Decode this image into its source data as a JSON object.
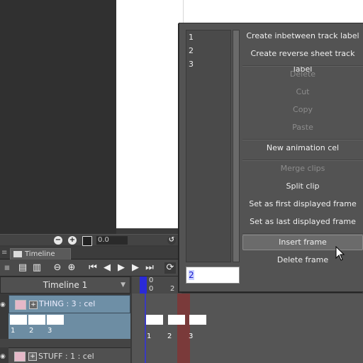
{
  "canvas": {
    "zoom_value": "0.0"
  },
  "panel": {
    "tab_label": "Timeline"
  },
  "timeline": {
    "name": "Timeline 1",
    "ruler_labels": [
      "0",
      "0",
      "2"
    ]
  },
  "layers": [
    {
      "label": "THING : 3 : cel",
      "cell_numbers": [
        "1",
        "2",
        "3"
      ]
    },
    {
      "label": "STUFF : 1 : cel"
    }
  ],
  "track": {
    "frame_numbers": [
      "1",
      "2",
      "3"
    ]
  },
  "context_menu": {
    "list_items": [
      "1",
      "2",
      "3"
    ],
    "input_value": "2",
    "items": [
      {
        "label": "Create inbetween track label",
        "enabled": true
      },
      {
        "label": "Create reverse sheet track label",
        "enabled": true
      },
      {
        "label": "Delete",
        "enabled": false
      },
      {
        "label": "Cut",
        "enabled": false
      },
      {
        "label": "Copy",
        "enabled": false
      },
      {
        "label": "Paste",
        "enabled": false
      },
      {
        "label": "New animation cel",
        "enabled": true
      },
      {
        "label": "Merge clips",
        "enabled": false
      },
      {
        "label": "Split clip",
        "enabled": true
      },
      {
        "label": "Set as first displayed frame",
        "enabled": true
      },
      {
        "label": "Set as last displayed frame",
        "enabled": true
      },
      {
        "label": "Insert frame",
        "enabled": true,
        "highlighted": true
      },
      {
        "label": "Delete frame",
        "enabled": true
      }
    ]
  }
}
